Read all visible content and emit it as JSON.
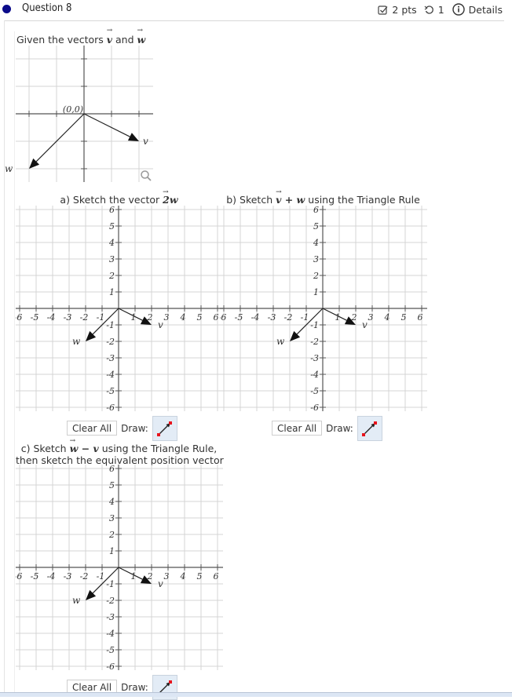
{
  "header": {
    "question_title": "Question 8",
    "points": "2 pts",
    "attempts": "1",
    "details_label": "Details",
    "icons": {
      "status": "filled-circle",
      "points": "checkbox-icon",
      "attempts": "retry-icon",
      "details": "info-icon"
    },
    "dot_color": "#0b0b8a"
  },
  "given": {
    "prompt_prefix": "Given the vectors ",
    "v": "v",
    "and": " and ",
    "w": "w",
    "origin_label": "(0,0)",
    "vector_labels": {
      "v": "v",
      "w": "w"
    },
    "zoom_icon": "magnifier-icon"
  },
  "vectors": {
    "v": [
      2,
      -1
    ],
    "w": [
      -2,
      -2
    ]
  },
  "parts": [
    {
      "id": "a",
      "title_prefix": "a) Sketch the vector ",
      "title_math": "2w",
      "title_suffix": "",
      "clear_label": "Clear All",
      "draw_label": "Draw:"
    },
    {
      "id": "b",
      "title_prefix": "b) Sketch ",
      "title_math": "v + w",
      "title_suffix": " using the Triangle Rule",
      "clear_label": "Clear All",
      "draw_label": "Draw:"
    },
    {
      "id": "c",
      "title_line1_prefix": "c) Sketch ",
      "title_math": "w − v",
      "title_line1_suffix": " using the Triangle Rule,",
      "title_line2": "then sketch the equivalent position vector",
      "clear_label": "Clear All",
      "draw_label": "Draw:"
    }
  ],
  "axis": {
    "x_ticks": [
      "-6",
      "-5",
      "-4",
      "-3",
      "-2",
      "-1",
      "1",
      "2",
      "3",
      "4",
      "5",
      "6"
    ],
    "y_ticks": [
      "6",
      "5",
      "4",
      "3",
      "2",
      "1",
      "-1",
      "-2",
      "-3",
      "-4",
      "-5",
      "-6"
    ],
    "range": [
      -6,
      6
    ]
  },
  "colors": {
    "grid": "#d4d4d4",
    "axis": "#555555",
    "draw_bg": "#e3ecf6",
    "draw_point": "#e8141c",
    "bottom_bar": "#dce6f4"
  }
}
